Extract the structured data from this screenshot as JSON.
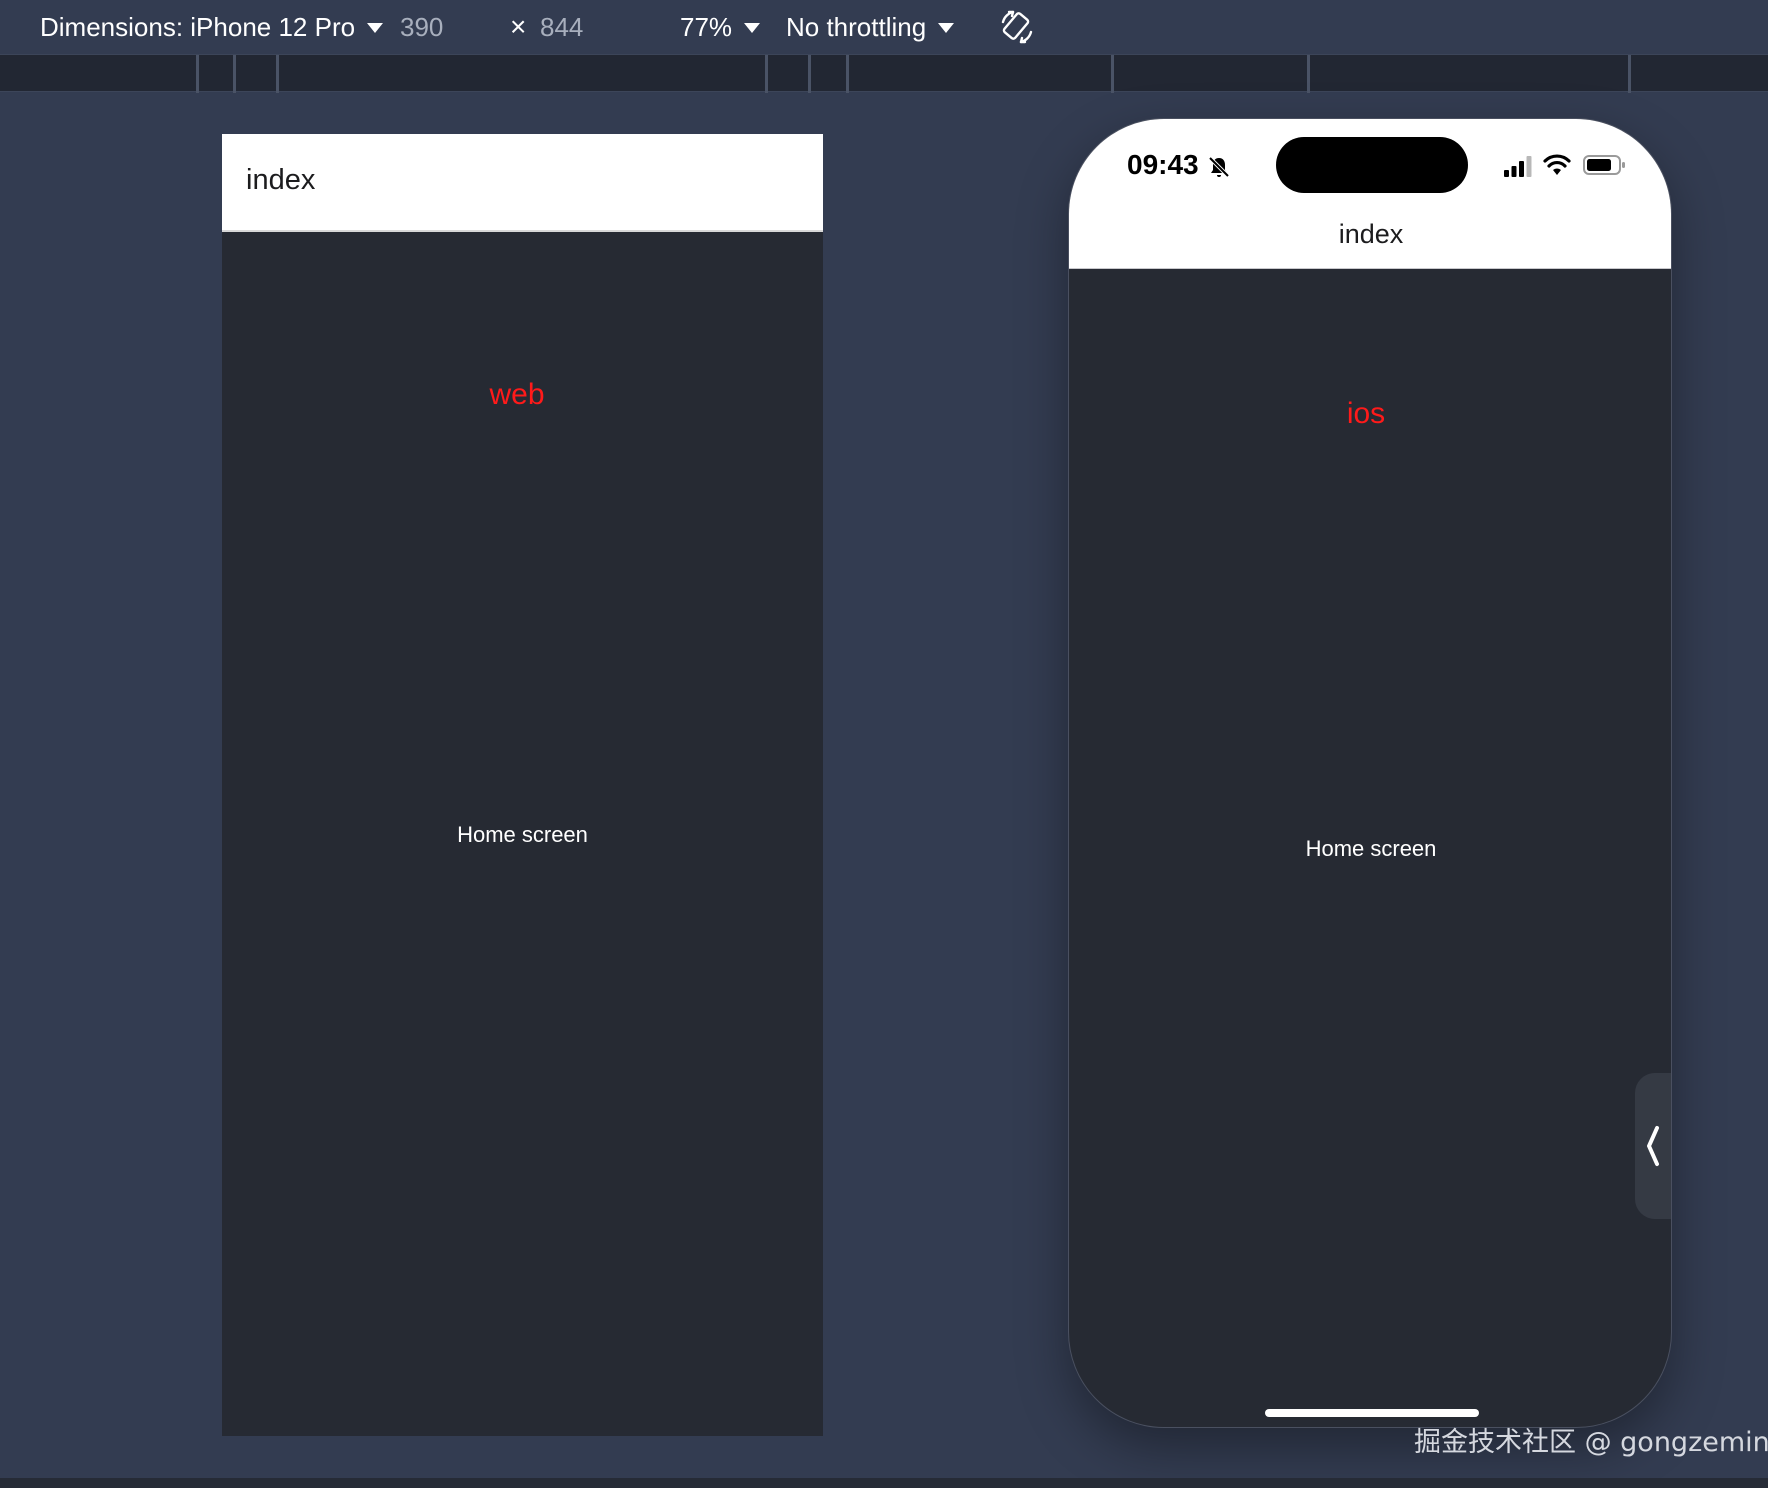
{
  "toolbar": {
    "dimensions_label": "Dimensions: iPhone 12 Pro",
    "width_value": "390",
    "times_symbol": "×",
    "height_value": "844",
    "zoom_label": "77%",
    "throttling_label": "No throttling",
    "rotate_icon": "rotate-device-icon"
  },
  "web_preview": {
    "header_title": "index",
    "platform_text": "web",
    "body_text": "Home screen"
  },
  "ios_preview": {
    "status_time": "09:43",
    "nav_title": "index",
    "platform_text": "ios",
    "body_text": "Home screen",
    "icons": [
      "bell-slash-icon",
      "cellular-signal-icon",
      "wifi-icon",
      "battery-icon",
      "chevron-left-icon"
    ]
  },
  "colors": {
    "page_bg": "#333c51",
    "preview_bg": "#262a33",
    "platform_text": "#ff1a1a",
    "header_bg": "#ffffff"
  },
  "watermark": "掘金技术社区 @ gongzemin"
}
